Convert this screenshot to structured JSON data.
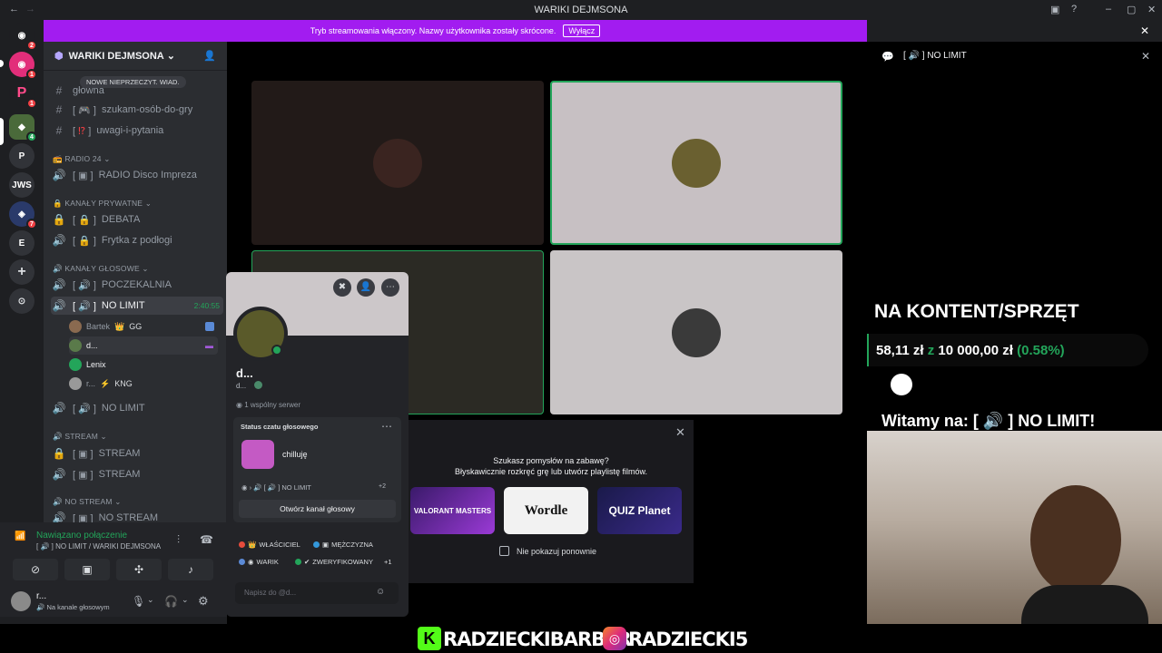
{
  "window": {
    "title": "WARIKI DEJMSONA"
  },
  "banner": {
    "text": "Tryb streamowania włączony. Nazwy użytkownika zostały skrócone.",
    "button": "Wyłącz"
  },
  "server": {
    "name": "WARIKI DEJMSONA",
    "new_unread": "NOWE NIEPRZECZYT. WIAD."
  },
  "guilds": [
    {
      "label": "",
      "badge": "2"
    },
    {
      "label": "",
      "badge": "1"
    },
    {
      "label": "",
      "badge": "1"
    },
    {
      "label": "",
      "badge": "4"
    },
    {
      "label": "P",
      "badge": ""
    },
    {
      "label": "JWS",
      "badge": ""
    },
    {
      "label": "",
      "badge": "7"
    },
    {
      "label": "E",
      "badge": ""
    }
  ],
  "channels": {
    "top_partial": "ᴀᴀᴀᴀ",
    "text1": "główna",
    "text2": "szukam-osób-do-gry",
    "text3": "uwagi-i-pytania",
    "cat_radio": "RADIO 24",
    "radio_disco": "RADIO Disco Impreza",
    "cat_private": "KANAŁY PRYWATNE",
    "debata": "DEBATA",
    "frytka": "Frytka z podłogi",
    "cat_voice": "KANAŁY GŁOSOWE",
    "poczekalnia": "POCZEKALNIA",
    "nolimit": "NO LIMIT",
    "nolimit_time": "2:40:55",
    "users": [
      {
        "name": "Bartek",
        "tag": "GG"
      },
      {
        "name": "d...",
        "tag": ""
      },
      {
        "name": "Lenix",
        "tag": ""
      },
      {
        "name": "r...",
        "tag": "KNG"
      }
    ],
    "nolimit2": "NO LIMIT",
    "cat_stream": "STREAM",
    "stream1": "STREAM",
    "stream2": "STREAM",
    "cat_nostream": "NO STREAM",
    "nostream1": "NO STREAM"
  },
  "voice": {
    "status": "Nawiązano połączenie",
    "location": "NO LIMIT / WARIKI DEJMSONA"
  },
  "userbar": {
    "name": "r...",
    "status": "Na kanale głosowym"
  },
  "popup": {
    "name": "d...",
    "sub": "d...",
    "mutual": "1 wspólny serwer",
    "voice_status_title": "Status czatu głosowego",
    "voice_status": "chilluję",
    "channel": "NO LIMIT",
    "extra": "+2",
    "open_btn": "Otwórz kanał głosowy",
    "roles": [
      "WŁAŚCICIEL",
      "MĘŻCZYZNA",
      "WARIK",
      "ZWERYFIKOWANY"
    ],
    "roles_more": "+1",
    "message_placeholder": "Napisz do @d..."
  },
  "activity": {
    "line1": "Szukasz pomysłów na zabawę?",
    "line2": "Błyskawicznie rozkręć grę lub utwórz playlistę filmów.",
    "games": [
      "VALORANT MASTERS",
      "Wordle",
      "QUIZ Planet"
    ],
    "dont_show": "Nie pokazuj ponownie"
  },
  "right": {
    "channel": "NO LIMIT",
    "kontent": "NA KONTENT/SPRZĘT",
    "goal_current": "58,11 zł",
    "goal_of": "z",
    "goal_target": "10 000,00 zł",
    "goal_pct": "(0.58%)",
    "goal_progress": 0.0058,
    "welcome": "Witamy na:",
    "welcome_channel": "NO LIMIT!"
  },
  "footer": {
    "left": "RADZIECKIBARBER",
    "right": "RADZIECKI5"
  },
  "colors": {
    "accent": "#a21cf0",
    "green": "#23a55a",
    "gold": "#f0b232"
  }
}
